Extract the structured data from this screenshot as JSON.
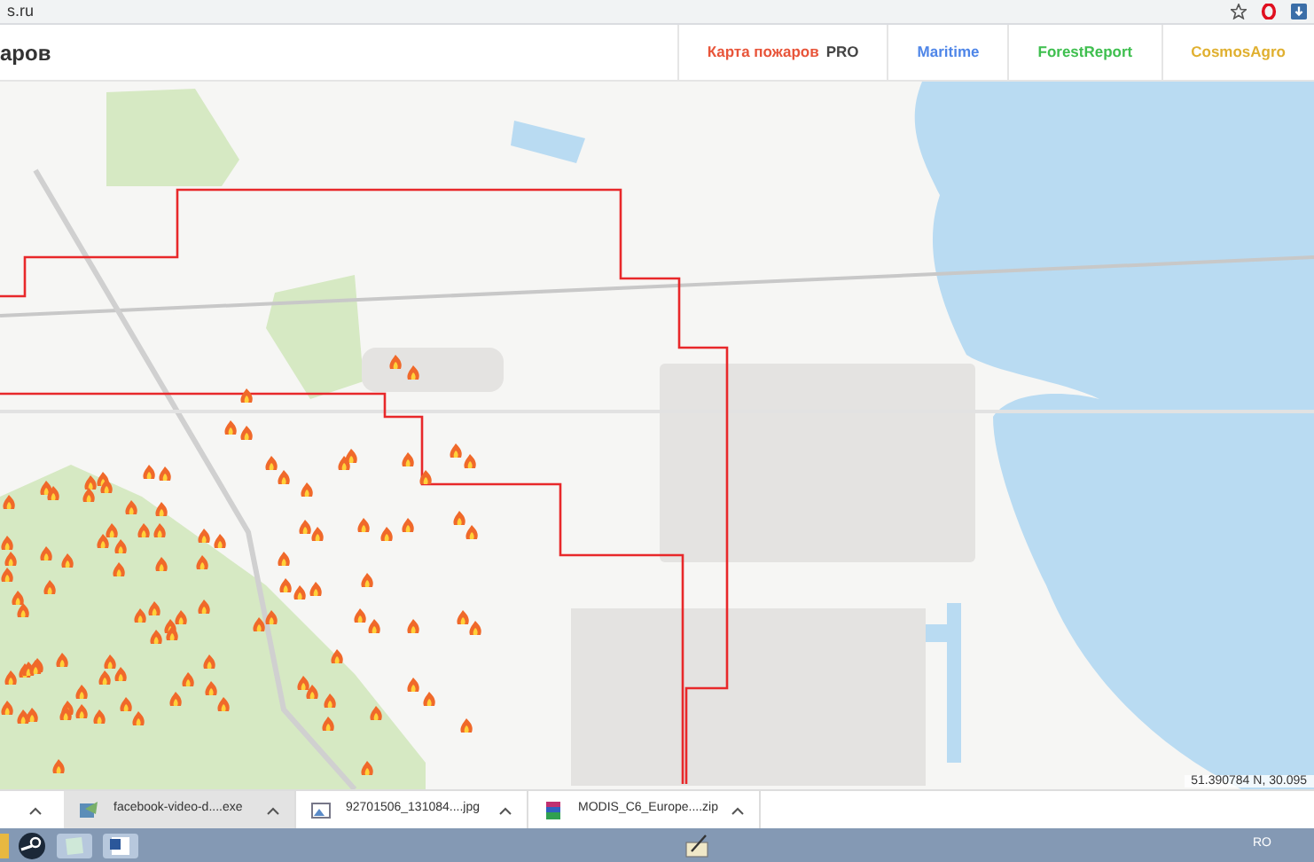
{
  "address_bar": {
    "url": "s.ru"
  },
  "header": {
    "title": "аров",
    "nav": [
      {
        "label": "Карта пожаров",
        "suffix": "PRO",
        "color": "#e8553a"
      },
      {
        "label": "Maritime",
        "color": "#4f86e8"
      },
      {
        "label": "ForestReport",
        "color": "#3fbf4f"
      },
      {
        "label": "CosmosAgro",
        "color": "#e0b030"
      }
    ]
  },
  "map": {
    "coordinates": "51.390784 N, 30.095"
  },
  "downloads": [
    {
      "name": "facebook-video-d....exe",
      "kind": "exe",
      "selected": true
    },
    {
      "name": "92701506_131084....jpg",
      "kind": "image",
      "selected": false
    },
    {
      "name": "MODIS_C6_Europe....zip",
      "kind": "archive",
      "selected": false
    }
  ],
  "taskbar": {
    "language": "RO"
  }
}
